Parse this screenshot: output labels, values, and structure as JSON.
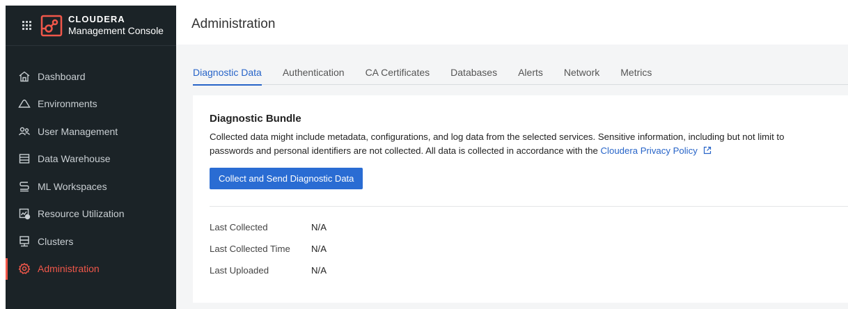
{
  "brand": {
    "name": "CLOUDERA",
    "subtitle": "Management Console",
    "accent": "#f0574a"
  },
  "sidebar": {
    "items": [
      {
        "label": "Dashboard",
        "icon": "home-icon",
        "active": false
      },
      {
        "label": "Environments",
        "icon": "cloud-icon",
        "active": false
      },
      {
        "label": "User Management",
        "icon": "users-icon",
        "active": false
      },
      {
        "label": "Data Warehouse",
        "icon": "database-icon",
        "active": false
      },
      {
        "label": "ML Workspaces",
        "icon": "ml-icon",
        "active": false
      },
      {
        "label": "Resource Utilization",
        "icon": "chart-icon",
        "active": false
      },
      {
        "label": "Clusters",
        "icon": "server-icon",
        "active": false
      },
      {
        "label": "Administration",
        "icon": "gear-icon",
        "active": true
      }
    ]
  },
  "header": {
    "title": "Administration"
  },
  "tabs": [
    {
      "label": "Diagnostic Data",
      "active": true
    },
    {
      "label": "Authentication",
      "active": false
    },
    {
      "label": "CA Certificates",
      "active": false
    },
    {
      "label": "Databases",
      "active": false
    },
    {
      "label": "Alerts",
      "active": false
    },
    {
      "label": "Network",
      "active": false
    },
    {
      "label": "Metrics",
      "active": false
    }
  ],
  "bundle": {
    "title": "Diagnostic Bundle",
    "description_line1": "Collected data might include metadata, configurations, and log data from the selected services. Sensitive information, including but not limit to",
    "description_line2": "passwords and personal identifiers are not collected. All data is collected in accordance with the ",
    "privacy_link": "Cloudera Privacy Policy",
    "collect_button": "Collect and Send Diagnostic Data",
    "fields": [
      {
        "label": "Last Collected",
        "value": "N/A"
      },
      {
        "label": "Last Collected Time",
        "value": "N/A"
      },
      {
        "label": "Last Uploaded",
        "value": "N/A"
      }
    ]
  },
  "colors": {
    "sidebar_bg": "#1b2327",
    "primary": "#2a6cd3",
    "link": "#2764c8",
    "active_nav": "#f0574a"
  }
}
